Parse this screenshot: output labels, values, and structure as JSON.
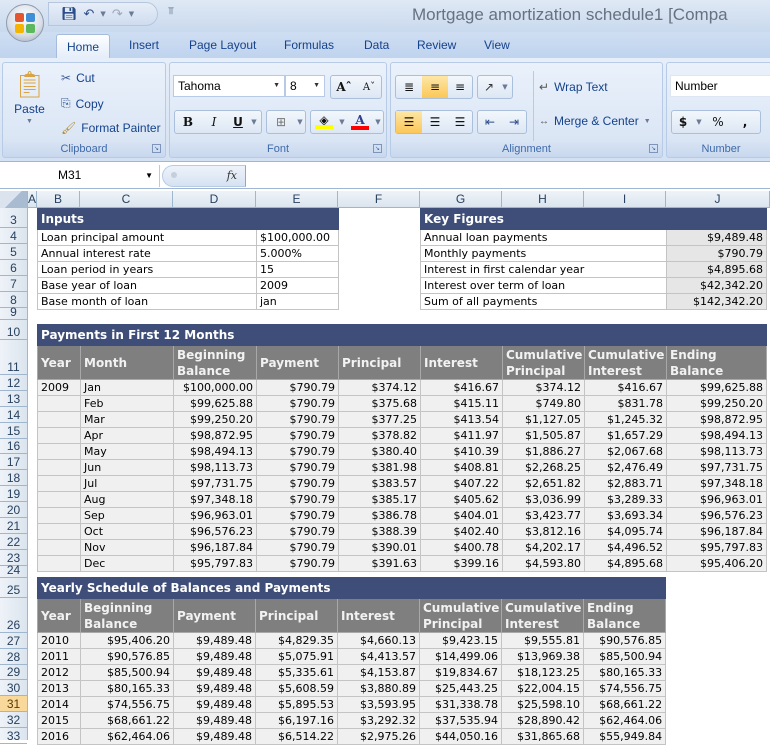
{
  "window": {
    "title": "Mortgage amortization schedule1  [Compa"
  },
  "quick_access": {
    "save": "save-icon",
    "undo": "undo-icon",
    "redo": "redo-icon"
  },
  "ribbon": {
    "tabs": [
      {
        "label": "Home",
        "active": true
      },
      {
        "label": "Insert"
      },
      {
        "label": "Page Layout"
      },
      {
        "label": "Formulas"
      },
      {
        "label": "Data"
      },
      {
        "label": "Review"
      },
      {
        "label": "View"
      }
    ],
    "clipboard": {
      "label": "Clipboard",
      "paste": "Paste",
      "cut": "Cut",
      "copy": "Copy",
      "format_painter": "Format Painter"
    },
    "font": {
      "label": "Font",
      "font_name": "Tahoma",
      "font_size": "8",
      "bold": "B",
      "italic": "I",
      "underline": "U",
      "fill_color": "#ffff00",
      "font_color": "#ff0000"
    },
    "alignment": {
      "label": "Alignment",
      "wrap_text": "Wrap Text",
      "merge_center": "Merge & Center"
    },
    "number": {
      "label": "Number",
      "format": "Number",
      "currency": "$",
      "percent": "%",
      "comma": ","
    }
  },
  "formula_bar": {
    "name_box": "M31",
    "fx": "fx",
    "formula": ""
  },
  "sheet": {
    "columns": [
      "A",
      "B",
      "C",
      "D",
      "E",
      "F",
      "G",
      "H",
      "I",
      "J"
    ],
    "rows": [
      "3",
      "4",
      "5",
      "6",
      "7",
      "8",
      "9",
      "10",
      "11",
      "12",
      "13",
      "14",
      "15",
      "16",
      "17",
      "18",
      "19",
      "20",
      "21",
      "22",
      "23",
      "24",
      "25",
      "26",
      "27",
      "28",
      "29",
      "30",
      "31",
      "32",
      "33"
    ],
    "selected_row": "31",
    "inputs": {
      "title": "Inputs",
      "rows": [
        {
          "label": "Loan principal amount",
          "value": "$100,000.00"
        },
        {
          "label": "Annual interest rate",
          "value": "5.000%"
        },
        {
          "label": "Loan period in years",
          "value": "15"
        },
        {
          "label": "Base year of loan",
          "value": "2009"
        },
        {
          "label": "Base month of loan",
          "value": "jan"
        }
      ]
    },
    "key_figures": {
      "title": "Key Figures",
      "rows": [
        {
          "label": "Annual loan payments",
          "value": "$9,489.48"
        },
        {
          "label": "Monthly payments",
          "value": "$790.79"
        },
        {
          "label": "Interest in first calendar year",
          "value": "$4,895.68"
        },
        {
          "label": "Interest over term of loan",
          "value": "$42,342.20"
        },
        {
          "label": "Sum of all payments",
          "value": "$142,342.20"
        }
      ]
    },
    "monthly": {
      "title": "Payments in First 12 Months",
      "headers": [
        "Year",
        "Month",
        "Beginning Balance",
        "Payment",
        "Principal",
        "Interest",
        "Cumulative Principal",
        "Cumulative Interest",
        "Ending Balance"
      ],
      "rows": [
        [
          "2009",
          "Jan",
          "$100,000.00",
          "$790.79",
          "$374.12",
          "$416.67",
          "$374.12",
          "$416.67",
          "$99,625.88"
        ],
        [
          "",
          "Feb",
          "$99,625.88",
          "$790.79",
          "$375.68",
          "$415.11",
          "$749.80",
          "$831.78",
          "$99,250.20"
        ],
        [
          "",
          "Mar",
          "$99,250.20",
          "$790.79",
          "$377.25",
          "$413.54",
          "$1,127.05",
          "$1,245.32",
          "$98,872.95"
        ],
        [
          "",
          "Apr",
          "$98,872.95",
          "$790.79",
          "$378.82",
          "$411.97",
          "$1,505.87",
          "$1,657.29",
          "$98,494.13"
        ],
        [
          "",
          "May",
          "$98,494.13",
          "$790.79",
          "$380.40",
          "$410.39",
          "$1,886.27",
          "$2,067.68",
          "$98,113.73"
        ],
        [
          "",
          "Jun",
          "$98,113.73",
          "$790.79",
          "$381.98",
          "$408.81",
          "$2,268.25",
          "$2,476.49",
          "$97,731.75"
        ],
        [
          "",
          "Jul",
          "$97,731.75",
          "$790.79",
          "$383.57",
          "$407.22",
          "$2,651.82",
          "$2,883.71",
          "$97,348.18"
        ],
        [
          "",
          "Aug",
          "$97,348.18",
          "$790.79",
          "$385.17",
          "$405.62",
          "$3,036.99",
          "$3,289.33",
          "$96,963.01"
        ],
        [
          "",
          "Sep",
          "$96,963.01",
          "$790.79",
          "$386.78",
          "$404.01",
          "$3,423.77",
          "$3,693.34",
          "$96,576.23"
        ],
        [
          "",
          "Oct",
          "$96,576.23",
          "$790.79",
          "$388.39",
          "$402.40",
          "$3,812.16",
          "$4,095.74",
          "$96,187.84"
        ],
        [
          "",
          "Nov",
          "$96,187.84",
          "$790.79",
          "$390.01",
          "$400.78",
          "$4,202.17",
          "$4,496.52",
          "$95,797.83"
        ],
        [
          "",
          "Dec",
          "$95,797.83",
          "$790.79",
          "$391.63",
          "$399.16",
          "$4,593.80",
          "$4,895.68",
          "$95,406.20"
        ]
      ]
    },
    "yearly": {
      "title": "Yearly Schedule of Balances and Payments",
      "headers": [
        "Year",
        "Beginning Balance",
        "Payment",
        "Principal",
        "Interest",
        "Cumulative Principal",
        "Cumulative Interest",
        "Ending Balance"
      ],
      "rows": [
        [
          "2010",
          "$95,406.20",
          "$9,489.48",
          "$4,829.35",
          "$4,660.13",
          "$9,423.15",
          "$9,555.81",
          "$90,576.85"
        ],
        [
          "2011",
          "$90,576.85",
          "$9,489.48",
          "$5,075.91",
          "$4,413.57",
          "$14,499.06",
          "$13,969.38",
          "$85,500.94"
        ],
        [
          "2012",
          "$85,500.94",
          "$9,489.48",
          "$5,335.61",
          "$4,153.87",
          "$19,834.67",
          "$18,123.25",
          "$80,165.33"
        ],
        [
          "2013",
          "$80,165.33",
          "$9,489.48",
          "$5,608.59",
          "$3,880.89",
          "$25,443.25",
          "$22,004.15",
          "$74,556.75"
        ],
        [
          "2014",
          "$74,556.75",
          "$9,489.48",
          "$5,895.53",
          "$3,593.95",
          "$31,338.78",
          "$25,598.10",
          "$68,661.22"
        ],
        [
          "2015",
          "$68,661.22",
          "$9,489.48",
          "$6,197.16",
          "$3,292.32",
          "$37,535.94",
          "$28,890.42",
          "$62,464.06"
        ],
        [
          "2016",
          "$62,464.06",
          "$9,489.48",
          "$6,514.22",
          "$2,975.26",
          "$44,050.16",
          "$31,865.68",
          "$55,949.84"
        ]
      ]
    }
  }
}
